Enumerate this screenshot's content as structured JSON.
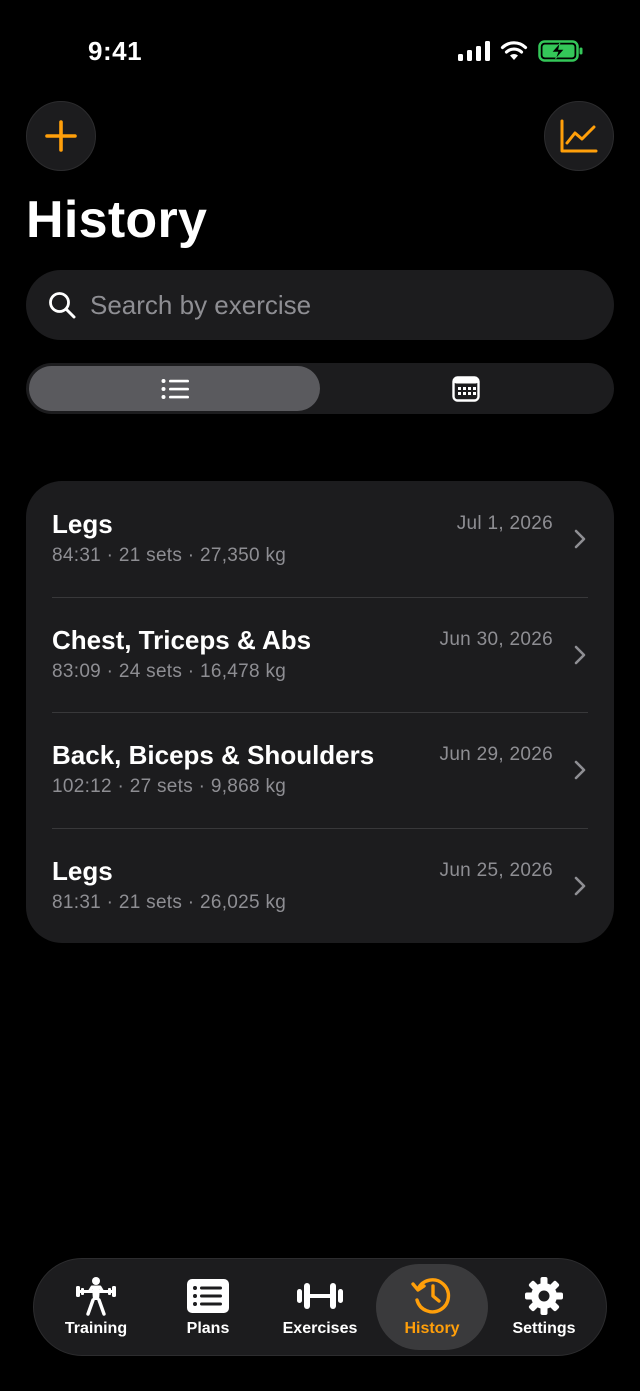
{
  "status_bar": {
    "time": "9:41"
  },
  "header": {
    "title": "History"
  },
  "search": {
    "placeholder": "Search by exercise",
    "value": ""
  },
  "view_toggle": {
    "selected": "list",
    "options": [
      "list-icon",
      "calendar-icon"
    ]
  },
  "colors": {
    "accent": "#ff9f0a",
    "background": "#000000",
    "card": "#1c1c1e",
    "secondary_text": "#8e8e93",
    "battery": "#34c759"
  },
  "workouts": [
    {
      "title": "Legs",
      "date": "Jul 1, 2026",
      "summary": "84:31 · 21 sets · 27,350 kg"
    },
    {
      "title": "Chest, Triceps & Abs",
      "date": "Jun 30, 2026",
      "summary": "83:09 · 24 sets · 16,478 kg"
    },
    {
      "title": "Back, Biceps & Shoulders",
      "date": "Jun 29, 2026",
      "summary": "102:12 · 27 sets · 9,868 kg"
    },
    {
      "title": "Legs",
      "date": "Jun 25, 2026",
      "summary": "81:31 · 21 sets · 26,025 kg"
    }
  ],
  "tab_bar": {
    "active": "History",
    "tabs": [
      {
        "label": "Training",
        "icon": "weightlifter-icon"
      },
      {
        "label": "Plans",
        "icon": "list-card-icon"
      },
      {
        "label": "Exercises",
        "icon": "dumbbell-icon"
      },
      {
        "label": "History",
        "icon": "history-clock-icon"
      },
      {
        "label": "Settings",
        "icon": "gear-icon"
      }
    ]
  }
}
